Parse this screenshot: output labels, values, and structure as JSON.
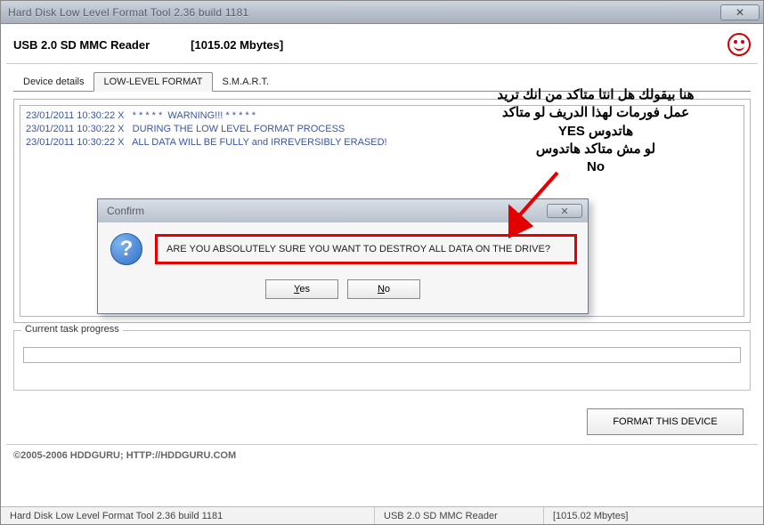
{
  "window": {
    "title": "Hard Disk Low Level Format Tool 2.36 build 1181"
  },
  "header": {
    "device": "USB 2.0 SD MMC Reader",
    "size": "[1015.02 Mbytes]"
  },
  "tabs": {
    "device_details": "Device details",
    "low_level_format": "LOW-LEVEL FORMAT",
    "smart": "S.M.A.R.T."
  },
  "log": {
    "line1": "23/01/2011 10:30:22 X   * * * * *  WARNING!!! * * * * *",
    "line2": "23/01/2011 10:30:22 X   DURING THE LOW LEVEL FORMAT PROCESS",
    "line3": "23/01/2011 10:30:22 X   ALL DATA WILL BE FULLY and IRREVERSIBLY ERASED!"
  },
  "progress": {
    "legend": "Current task progress"
  },
  "format_button": "FORMAT THIS DEVICE",
  "footer": "©2005-2006 HDDGURU;  HTTP://HDDGURU.COM",
  "statusbar": {
    "app": "Hard Disk Low Level Format Tool 2.36 build 1181",
    "device": "USB 2.0 SD MMC Reader",
    "size": "[1015.02 Mbytes]"
  },
  "confirm": {
    "title": "Confirm",
    "message": "ARE YOU ABSOLUTELY SURE YOU WANT TO DESTROY ALL DATA ON THE DRIVE?",
    "yes": "Yes",
    "no": "No"
  },
  "annotation": {
    "l1": "هنا بيقولك هل انتا متاكد من انك تريد",
    "l2": "عمل فورمات لهذا الدريف لو متاكد",
    "l3": "هاتدوس YES",
    "l4": "لو مش متاكد هاتدوس",
    "l5": "No"
  }
}
